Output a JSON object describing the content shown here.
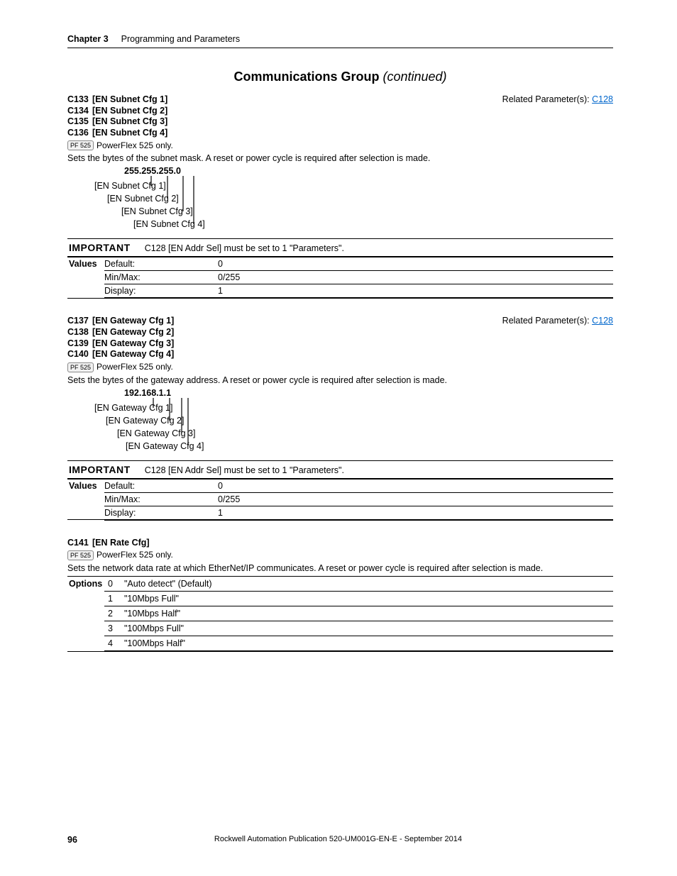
{
  "header": {
    "chapter_label": "Chapter 3",
    "chapter_title": "Programming and Parameters"
  },
  "group_title": "Communications Group",
  "group_continued": "(continued)",
  "pf_badge": "PF 525",
  "pf_only_text": "PowerFlex 525 only.",
  "related_label": "Related Parameter(s): ",
  "related_link": "C128",
  "important_label": "IMPORTANT",
  "values_label": "Values",
  "options_label": "Options",
  "value_keys": {
    "default": "Default:",
    "minmax": "Min/Max:",
    "display": "Display:"
  },
  "subnet": {
    "params": [
      {
        "code": "C133",
        "name": "[EN Subnet Cfg 1]"
      },
      {
        "code": "C134",
        "name": "[EN Subnet Cfg 2]"
      },
      {
        "code": "C135",
        "name": "[EN Subnet Cfg 3]"
      },
      {
        "code": "C136",
        "name": "[EN Subnet Cfg 4]"
      }
    ],
    "desc": "Sets the bytes of the subnet mask. A reset or power cycle is required after selection is made.",
    "ip_example": "255.255.255.0",
    "labels": [
      "[EN Subnet Cfg 1]",
      "[EN Subnet Cfg 2]",
      "[EN Subnet Cfg 3]",
      "[EN Subnet Cfg 4]"
    ],
    "important": "C128 [EN Addr Sel] must be set to 1 \"Parameters\".",
    "values": {
      "default": "0",
      "minmax": "0/255",
      "display": "1"
    }
  },
  "gateway": {
    "params": [
      {
        "code": "C137",
        "name": "[EN Gateway Cfg 1]"
      },
      {
        "code": "C138",
        "name": "[EN Gateway Cfg 2]"
      },
      {
        "code": "C139",
        "name": "[EN Gateway Cfg 3]"
      },
      {
        "code": "C140",
        "name": "[EN Gateway Cfg 4]"
      }
    ],
    "desc": "Sets the bytes of the gateway address. A reset or power cycle is required after selection is made.",
    "ip_example": "192.168.1.1",
    "labels": [
      "[EN Gateway Cfg 1]",
      "[EN Gateway Cfg 2]",
      "[EN Gateway Cfg 3]",
      "[EN Gateway Cfg 4]"
    ],
    "important": "C128 [EN Addr Sel] must be set to 1 \"Parameters\".",
    "values": {
      "default": "0",
      "minmax": "0/255",
      "display": "1"
    }
  },
  "rate": {
    "param": {
      "code": "C141",
      "name": "[EN Rate Cfg]"
    },
    "desc": "Sets the network data rate at which EtherNet/IP communicates. A reset or power cycle is required after selection is made.",
    "options": [
      {
        "idx": "0",
        "text": "\"Auto detect\" (Default)"
      },
      {
        "idx": "1",
        "text": "\"10Mbps Full\""
      },
      {
        "idx": "2",
        "text": "\"10Mbps Half\""
      },
      {
        "idx": "3",
        "text": "\"100Mbps Full\""
      },
      {
        "idx": "4",
        "text": "\"100Mbps Half\""
      }
    ]
  },
  "footer": {
    "page": "96",
    "publication": "Rockwell Automation Publication 520-UM001G-EN-E - September 2014"
  }
}
